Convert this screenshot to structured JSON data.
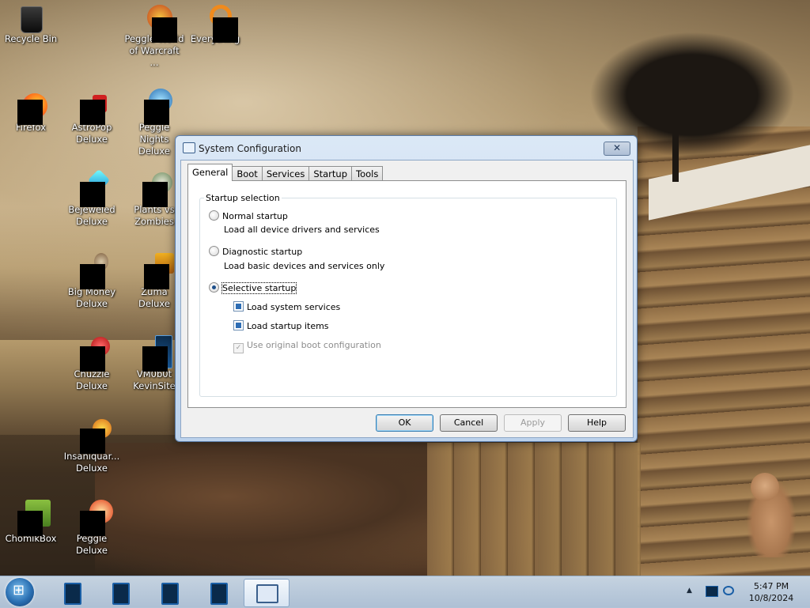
{
  "desktop": {
    "icons": [
      {
        "label": "Recycle Bin"
      },
      {
        "label": "Peggle World of Warcraft ..."
      },
      {
        "label": "Everything"
      },
      {
        "label": "Firefox"
      },
      {
        "label": "AstroPop Deluxe"
      },
      {
        "label": "Peggle Nights Deluxe"
      },
      {
        "label": "Bejeweled Deluxe"
      },
      {
        "label": "Plants vs Zombies"
      },
      {
        "label": "Big Money Deluxe"
      },
      {
        "label": "Zuma Deluxe"
      },
      {
        "label": "Chuzzle Deluxe"
      },
      {
        "label": "VM0b0t KevinSite"
      },
      {
        "label": "Insaniquar... Deluxe"
      },
      {
        "label": "ChomikBox"
      },
      {
        "label": "Peggle Deluxe"
      }
    ]
  },
  "window": {
    "title": "System Configuration",
    "close_label": "✕",
    "tabs": [
      "General",
      "Boot",
      "Services",
      "Startup",
      "Tools"
    ],
    "active_tab": "General",
    "group_title": "Startup selection",
    "options": {
      "normal": {
        "label": "Normal startup",
        "description": "Load all device drivers and services",
        "selected": false
      },
      "diagnostic": {
        "label": "Diagnostic startup",
        "description": "Load basic devices and services only",
        "selected": false
      },
      "selective": {
        "label": "Selective startup",
        "selected": true
      }
    },
    "selective_items": {
      "system_services": {
        "label": "Load system services",
        "checked": true
      },
      "startup_items": {
        "label": "Load startup items",
        "checked": true
      },
      "original_boot": {
        "label": "Use original boot configuration",
        "checked": true,
        "disabled": true
      }
    },
    "buttons": {
      "ok": "OK",
      "cancel": "Cancel",
      "apply": "Apply",
      "help": "Help"
    }
  },
  "taskbar": {
    "clock": {
      "time": "5:47 PM",
      "date": "10/8/2024"
    },
    "tray_arrow": "▲"
  },
  "colors": {
    "accent": "#2e6db4",
    "taskbar": "#c8d8ea"
  }
}
